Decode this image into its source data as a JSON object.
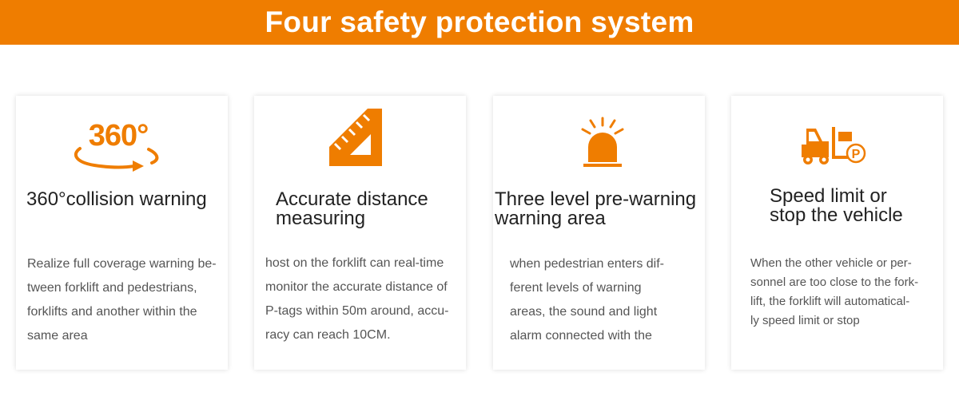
{
  "header": {
    "title": "Four safety protection system"
  },
  "colors": {
    "accent": "#ef7d00",
    "banner_text": "#ffffff",
    "title_text": "#222222",
    "body_text": "#555555"
  },
  "cards": [
    {
      "icon": "360-rotation-icon",
      "icon_text": "360°",
      "title_lines": [
        "360°collision warning"
      ],
      "desc_lines": [
        "Realize full coverage warning be-",
        "tween forklift and pedestrians,",
        "forklifts and another within the",
        "same area"
      ]
    },
    {
      "icon": "triangle-ruler-icon",
      "title_lines": [
        "Accurate distance",
        "measuring"
      ],
      "desc_lines": [
        "host on the forklift can real-time",
        "monitor the accurate distance of",
        "P-tags within 50m around, accu-",
        "racy can reach 10CM."
      ]
    },
    {
      "icon": "warning-beacon-icon",
      "title_lines": [
        "Three level pre-warning",
        "warning area"
      ],
      "desc_lines": [
        "when pedestrian enters dif-",
        "ferent levels of warning",
        "areas, the sound and light",
        "alarm connected with the"
      ]
    },
    {
      "icon": "forklift-parking-icon",
      "title_lines": [
        "Speed limit or",
        "stop the vehicle"
      ],
      "desc_lines": [
        "When the other vehicle or per-",
        "sonnel are too close to the fork-",
        "lift, the forklift will automatical-",
        "ly speed limit or stop"
      ]
    }
  ]
}
